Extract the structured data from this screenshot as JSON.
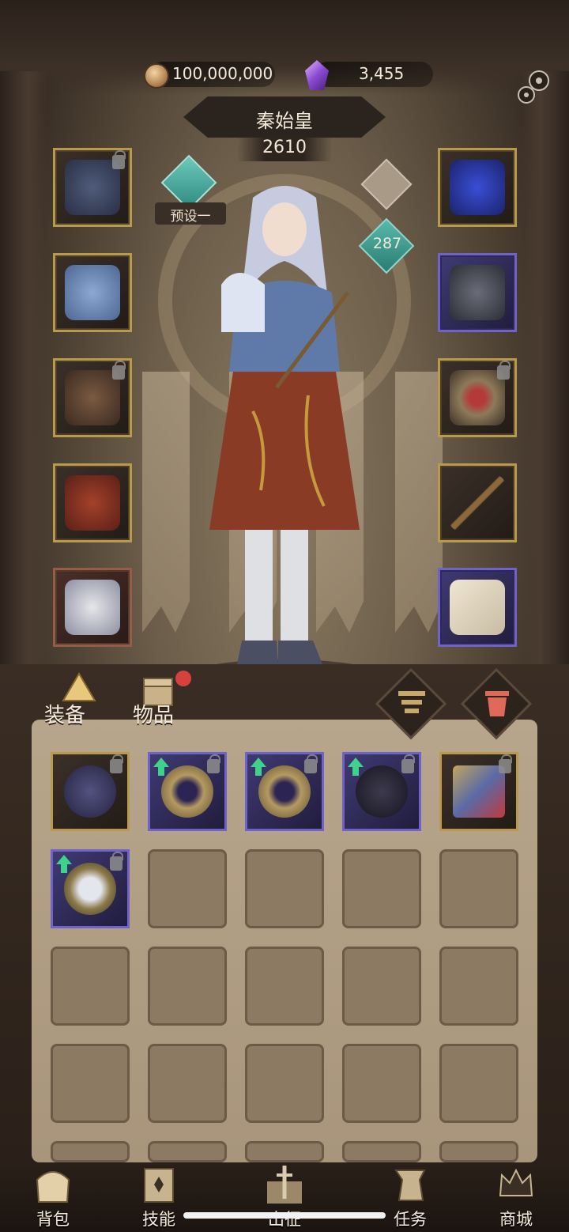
{
  "header": {
    "gold": "100,000,000",
    "gems": "3,455",
    "character_name": "秦始皇",
    "power": "2610",
    "preset_label": "预设一",
    "level": "287"
  },
  "equipment_left": [
    {
      "name": "helmet",
      "frame": "gold",
      "locked": true
    },
    {
      "name": "armor",
      "frame": "gold",
      "locked": false
    },
    {
      "name": "gloves",
      "frame": "gold",
      "locked": true
    },
    {
      "name": "skirt",
      "frame": "gold",
      "locked": false
    },
    {
      "name": "boots",
      "frame": "red",
      "locked": false
    }
  ],
  "equipment_right": [
    {
      "name": "necklace",
      "frame": "gold",
      "locked": false
    },
    {
      "name": "ring",
      "frame": "purple",
      "locked": false
    },
    {
      "name": "serpent-ring",
      "frame": "gold",
      "locked": true
    },
    {
      "name": "staff",
      "frame": "gold",
      "locked": false
    },
    {
      "name": "scroll",
      "frame": "purple",
      "locked": false
    }
  ],
  "tabs": {
    "equipment": "装备",
    "items": "物品"
  },
  "inventory": [
    {
      "name": "claw-gauntlet",
      "frame": "gold",
      "locked": true,
      "upgrade": false
    },
    {
      "name": "ring-1",
      "frame": "purple",
      "locked": true,
      "upgrade": true
    },
    {
      "name": "ring-2",
      "frame": "purple",
      "locked": true,
      "upgrade": true
    },
    {
      "name": "spider-armor",
      "frame": "purple",
      "locked": true,
      "upgrade": true
    },
    {
      "name": "spellbook",
      "frame": "gold",
      "locked": true,
      "upgrade": false
    },
    {
      "name": "amulet-shield",
      "frame": "purple",
      "locked": true,
      "upgrade": true
    }
  ],
  "nav": {
    "bag": "背包",
    "skills": "技能",
    "expedition": "出征",
    "quests": "任务",
    "shop": "商城"
  },
  "colors": {
    "gold_frame": "#b99a4c",
    "purple_frame": "#6f63c9",
    "upgrade_arrow": "#3fd28a",
    "notification_dot": "#d5423d"
  }
}
